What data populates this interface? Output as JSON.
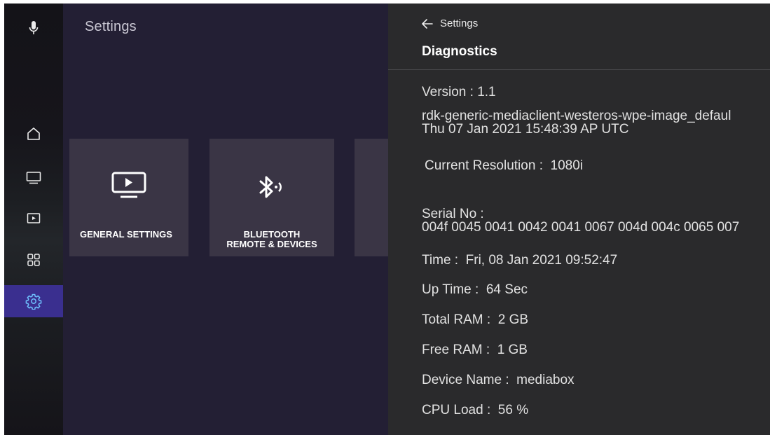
{
  "sidebar": {
    "items": [
      {
        "name": "mic",
        "icon": "microphone-icon"
      },
      {
        "name": "home",
        "icon": "home-icon"
      },
      {
        "name": "tv",
        "icon": "tv-icon"
      },
      {
        "name": "media",
        "icon": "play-screen-icon"
      },
      {
        "name": "apps",
        "icon": "apps-grid-icon"
      },
      {
        "name": "settings",
        "icon": "gear-icon",
        "active": true
      }
    ],
    "accent_color": "#3a2f8f"
  },
  "main": {
    "title": "Settings",
    "tiles": [
      {
        "label": "GENERAL SETTINGS",
        "icon": "tv-play-icon"
      },
      {
        "label_line1": "BLUETOOTH",
        "label_line2": "REMOTE & DEVICES",
        "icon": "bluetooth-icon"
      }
    ]
  },
  "panel": {
    "back_label": "Settings",
    "title": "Diagnostics",
    "version": "Version : 1.1",
    "build_line1": "rdk-generic-mediaclient-westeros-wpe-image_defaul",
    "build_line2": "Thu 07 Jan 2021 15:48:39 AP UTC",
    "resolution_label": "Current Resolution :",
    "resolution_value": "1080i",
    "serial_label": "Serial No :",
    "serial_value": "004f 0045 0041 0042 0041 0067 004d 004c 0065 007",
    "time_label": "Time :",
    "time_value": "Fri, 08 Jan 2021 09:52:47",
    "uptime_label": "Up Time :",
    "uptime_value": "64 Sec",
    "total_ram_label": "Total RAM :",
    "total_ram_value": "2 GB",
    "free_ram_label": "Free RAM :",
    "free_ram_value": "1 GB",
    "device_name_label": "Device Name :",
    "device_name_value": "mediabox",
    "cpu_label": "CPU Load :",
    "cpu_value": "56 %"
  }
}
